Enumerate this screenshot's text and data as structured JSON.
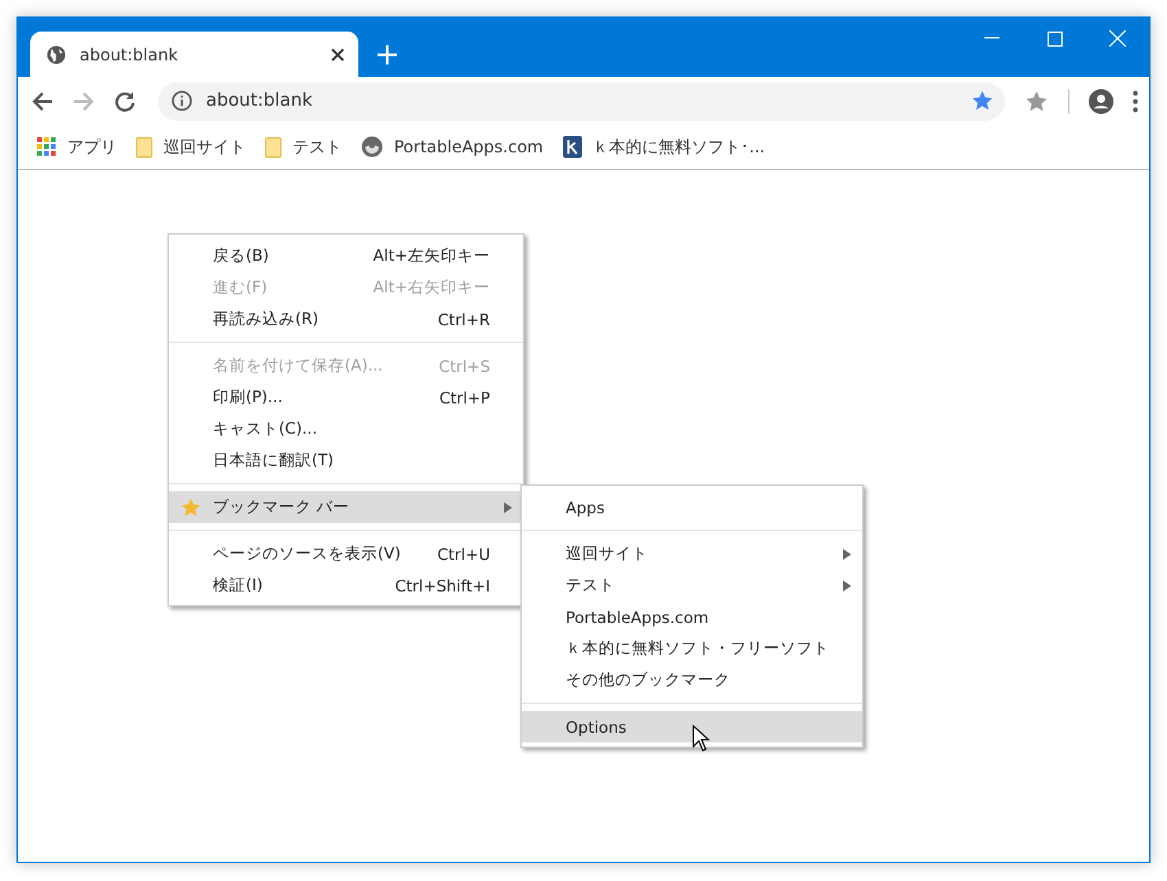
{
  "tab": {
    "title": "about:blank",
    "selected": true
  },
  "address": {
    "value": "about:blank",
    "bookmarked": true
  },
  "bookmarks": [
    {
      "kind": "apps",
      "label": "アプリ"
    },
    {
      "kind": "folder",
      "label": "巡回サイト"
    },
    {
      "kind": "folder",
      "label": "テスト"
    },
    {
      "kind": "globe",
      "label": "PortableApps.com"
    },
    {
      "kind": "k",
      "label": "ｋ本的に無料ソフト･..."
    }
  ],
  "context_menu": [
    {
      "kind": "item",
      "label": "戻る(B)",
      "shortcut": "Alt+左矢印キー",
      "disabled": false,
      "selected": false
    },
    {
      "kind": "item",
      "label": "進む(F)",
      "shortcut": "Alt+右矢印キー",
      "disabled": true,
      "selected": false
    },
    {
      "kind": "item",
      "label": "再読み込み(R)",
      "shortcut": "Ctrl+R",
      "disabled": false,
      "selected": false
    },
    {
      "kind": "separator"
    },
    {
      "kind": "item",
      "label": "名前を付けて保存(A)...",
      "shortcut": "Ctrl+S",
      "disabled": true,
      "selected": false
    },
    {
      "kind": "item",
      "label": "印刷(P)...",
      "shortcut": "Ctrl+P",
      "disabled": false,
      "selected": false
    },
    {
      "kind": "item",
      "label": "キャスト(C)...",
      "disabled": false,
      "selected": false
    },
    {
      "kind": "item",
      "label": "日本語に翻訳(T)",
      "disabled": false,
      "selected": false
    },
    {
      "kind": "separator"
    },
    {
      "kind": "item",
      "label": "ブックマーク バー",
      "star": true,
      "submenu": true,
      "disabled": false,
      "selected": true
    },
    {
      "kind": "separator"
    },
    {
      "kind": "item",
      "label": "ページのソースを表示(V)",
      "shortcut": "Ctrl+U",
      "disabled": false,
      "selected": false
    },
    {
      "kind": "item",
      "label": "検証(I)",
      "shortcut": "Ctrl+Shift+I",
      "disabled": false,
      "selected": false
    }
  ],
  "submenu": [
    {
      "kind": "item",
      "label": "Apps",
      "disabled": false,
      "selected": false
    },
    {
      "kind": "separator"
    },
    {
      "kind": "item",
      "label": "巡回サイト",
      "submenu": true,
      "disabled": false,
      "selected": false
    },
    {
      "kind": "item",
      "label": "テスト",
      "submenu": true,
      "disabled": false,
      "selected": false
    },
    {
      "kind": "item",
      "label": "PortableApps.com",
      "disabled": false,
      "selected": false
    },
    {
      "kind": "item",
      "label": "ｋ本的に無料ソフト・フリーソフト",
      "disabled": false,
      "selected": false
    },
    {
      "kind": "item",
      "label": "その他のブックマーク",
      "disabled": false,
      "selected": false
    },
    {
      "kind": "separator"
    },
    {
      "kind": "item",
      "label": "Options",
      "disabled": false,
      "selected": true
    }
  ]
}
